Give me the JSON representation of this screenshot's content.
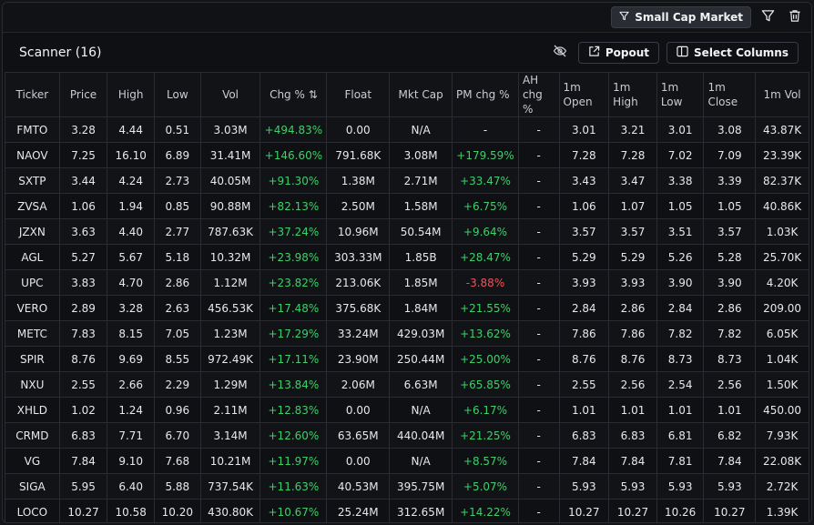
{
  "topbar": {
    "preset_label": "Small Cap Market"
  },
  "header": {
    "title": "Scanner (16)",
    "popout_label": "Popout",
    "select_columns_label": "Select Columns"
  },
  "columns": [
    "Ticker",
    "Price",
    "High",
    "Low",
    "Vol",
    "Chg % ⇅",
    "Float",
    "Mkt Cap",
    "PM chg %",
    "AH chg %",
    "1m Open",
    "1m High",
    "1m Low",
    "1m Close",
    "1m Vol"
  ],
  "rows": [
    [
      "FMTO",
      "3.28",
      "4.44",
      "0.51",
      "3.03M",
      "+494.83%",
      "0.00",
      "N/A",
      "-",
      "-",
      "3.01",
      "3.21",
      "3.01",
      "3.08",
      "43.87K"
    ],
    [
      "NAOV",
      "7.25",
      "16.10",
      "6.89",
      "31.41M",
      "+146.60%",
      "791.68K",
      "3.08M",
      "+179.59%",
      "-",
      "7.28",
      "7.28",
      "7.02",
      "7.09",
      "23.39K"
    ],
    [
      "SXTP",
      "3.44",
      "4.24",
      "2.73",
      "40.05M",
      "+91.30%",
      "1.38M",
      "2.71M",
      "+33.47%",
      "-",
      "3.43",
      "3.47",
      "3.38",
      "3.39",
      "82.37K"
    ],
    [
      "ZVSA",
      "1.06",
      "1.94",
      "0.85",
      "90.88M",
      "+82.13%",
      "2.50M",
      "1.58M",
      "+6.75%",
      "-",
      "1.06",
      "1.07",
      "1.05",
      "1.05",
      "40.86K"
    ],
    [
      "JZXN",
      "3.63",
      "4.40",
      "2.77",
      "787.63K",
      "+37.24%",
      "10.96M",
      "50.54M",
      "+9.64%",
      "-",
      "3.57",
      "3.57",
      "3.51",
      "3.57",
      "1.03K"
    ],
    [
      "AGL",
      "5.27",
      "5.67",
      "5.18",
      "10.32M",
      "+23.98%",
      "303.33M",
      "1.85B",
      "+28.47%",
      "-",
      "5.29",
      "5.29",
      "5.26",
      "5.28",
      "25.70K"
    ],
    [
      "UPC",
      "3.83",
      "4.70",
      "2.86",
      "1.12M",
      "+23.82%",
      "213.06K",
      "1.85M",
      "-3.88%",
      "-",
      "3.93",
      "3.93",
      "3.90",
      "3.90",
      "4.20K"
    ],
    [
      "VERO",
      "2.89",
      "3.28",
      "2.63",
      "456.53K",
      "+17.48%",
      "375.68K",
      "1.84M",
      "+21.55%",
      "-",
      "2.84",
      "2.86",
      "2.84",
      "2.86",
      "209.00"
    ],
    [
      "METC",
      "7.83",
      "8.15",
      "7.05",
      "1.23M",
      "+17.29%",
      "33.24M",
      "429.03M",
      "+13.62%",
      "-",
      "7.86",
      "7.86",
      "7.82",
      "7.82",
      "6.05K"
    ],
    [
      "SPIR",
      "8.76",
      "9.69",
      "8.55",
      "972.49K",
      "+17.11%",
      "23.90M",
      "250.44M",
      "+25.00%",
      "-",
      "8.76",
      "8.76",
      "8.73",
      "8.73",
      "1.04K"
    ],
    [
      "NXU",
      "2.55",
      "2.66",
      "2.29",
      "1.29M",
      "+13.84%",
      "2.06M",
      "6.63M",
      "+65.85%",
      "-",
      "2.55",
      "2.56",
      "2.54",
      "2.56",
      "1.50K"
    ],
    [
      "XHLD",
      "1.02",
      "1.24",
      "0.96",
      "2.11M",
      "+12.83%",
      "0.00",
      "N/A",
      "+6.17%",
      "-",
      "1.01",
      "1.01",
      "1.01",
      "1.01",
      "450.00"
    ],
    [
      "CRMD",
      "6.83",
      "7.71",
      "6.70",
      "3.14M",
      "+12.60%",
      "63.65M",
      "440.04M",
      "+21.25%",
      "-",
      "6.83",
      "6.83",
      "6.81",
      "6.82",
      "7.93K"
    ],
    [
      "VG",
      "7.84",
      "9.10",
      "7.68",
      "10.21M",
      "+11.97%",
      "0.00",
      "N/A",
      "+8.57%",
      "-",
      "7.84",
      "7.84",
      "7.81",
      "7.84",
      "22.08K"
    ],
    [
      "SIGA",
      "5.95",
      "6.40",
      "5.88",
      "737.54K",
      "+11.63%",
      "40.53M",
      "395.75M",
      "+5.07%",
      "-",
      "5.93",
      "5.93",
      "5.93",
      "5.93",
      "2.72K"
    ],
    [
      "LOCO",
      "10.27",
      "10.58",
      "10.20",
      "430.80K",
      "+10.67%",
      "25.24M",
      "312.65M",
      "+14.22%",
      "-",
      "10.27",
      "10.27",
      "10.26",
      "10.27",
      "1.39K"
    ]
  ],
  "colors": {
    "up": "#3ecf6a",
    "down": "#f0525a"
  },
  "icons": [
    "filter-icon",
    "trash-icon",
    "eye-off-icon",
    "external-link-icon",
    "columns-icon"
  ]
}
